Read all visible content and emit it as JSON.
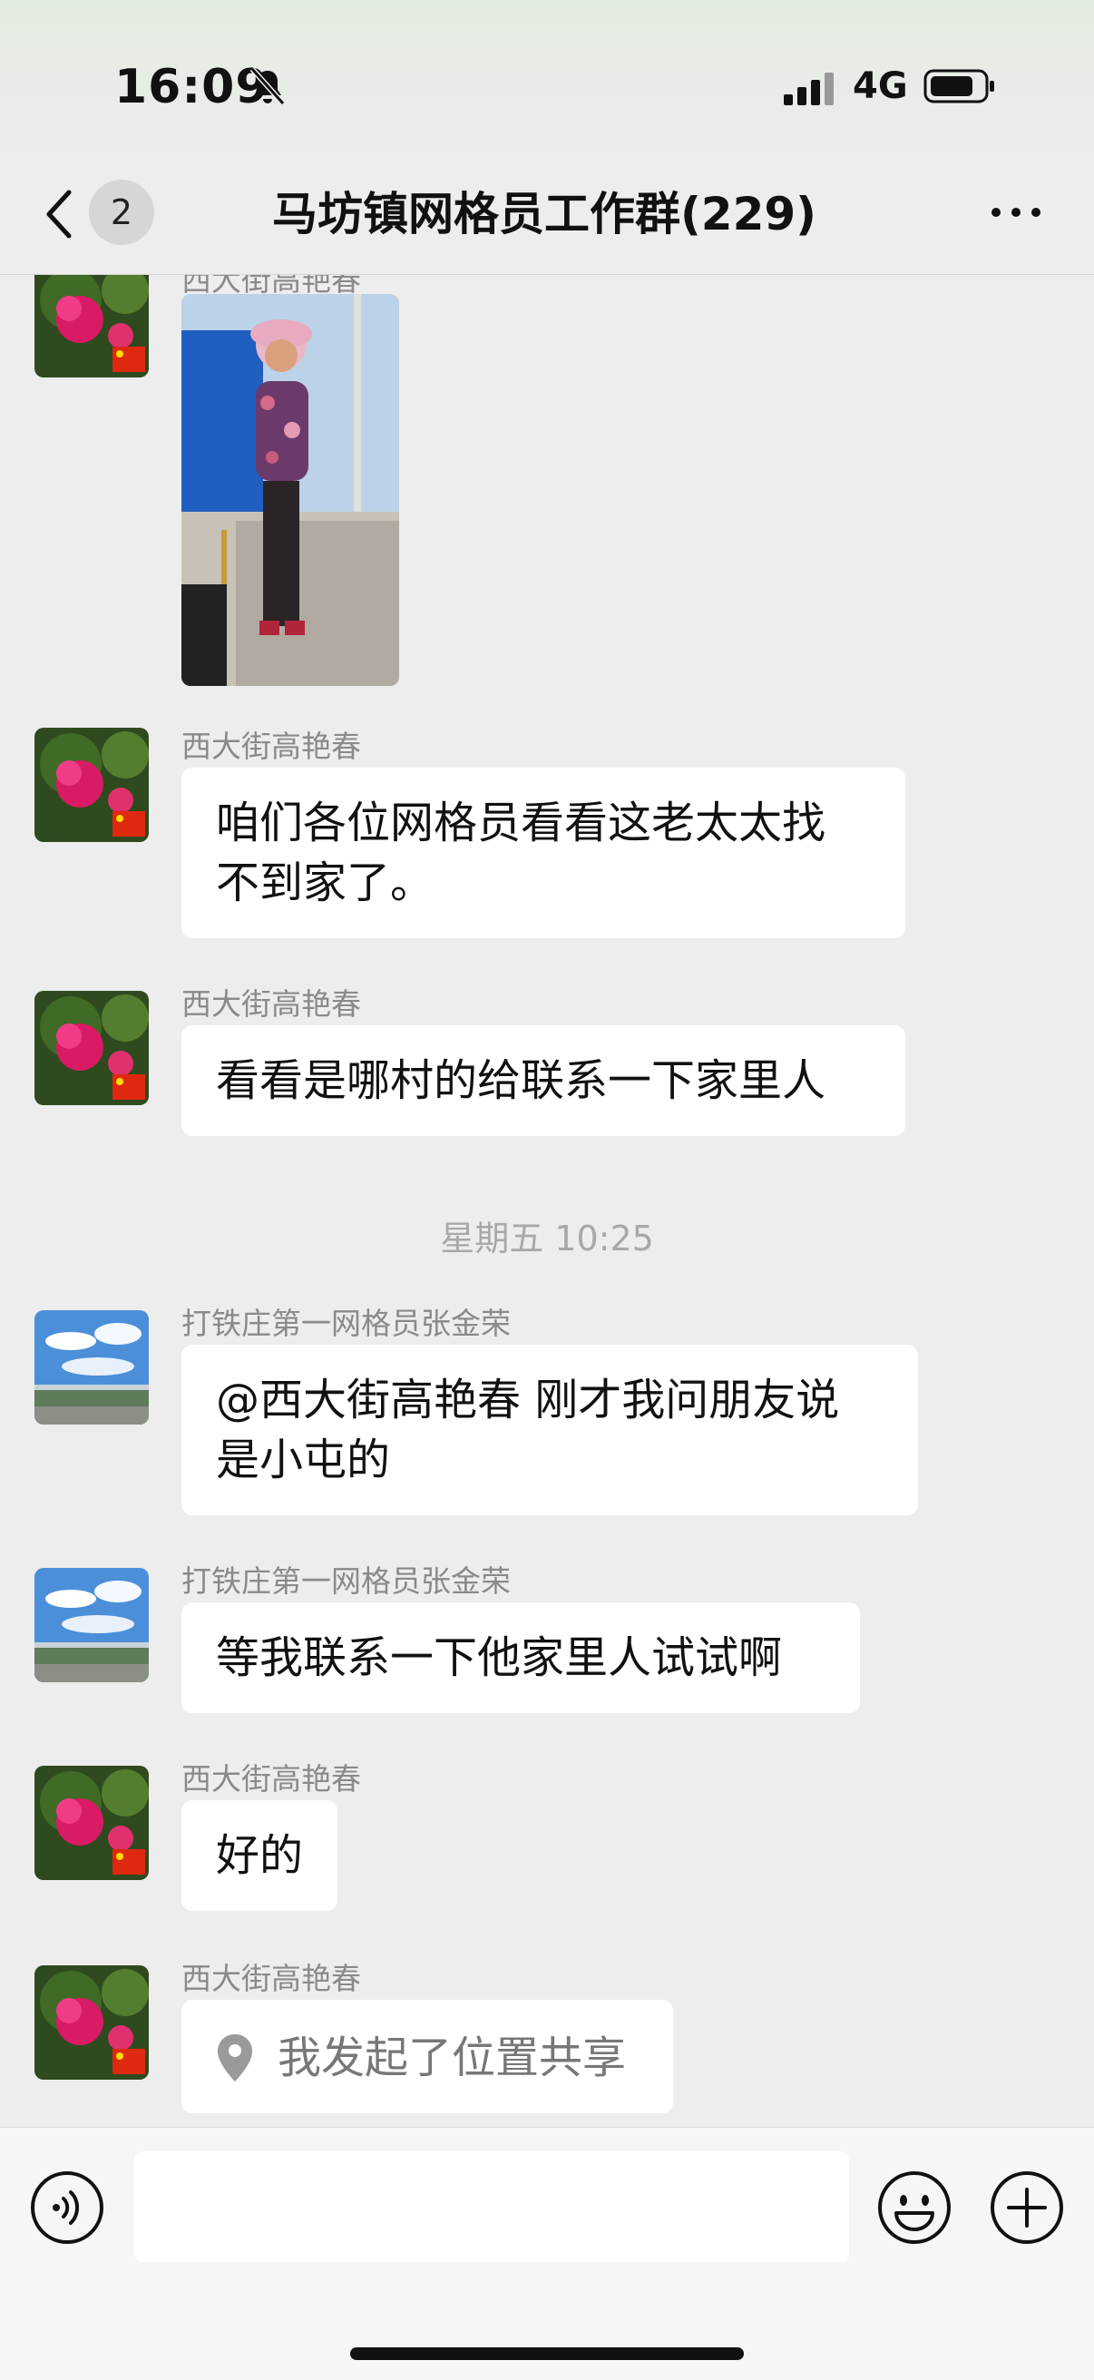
{
  "status_bar": {
    "time": "16:09",
    "network": "4G"
  },
  "nav": {
    "unread_count": "2",
    "title": "马坊镇网格员工作群(229)"
  },
  "messages": [
    {
      "sender": "西大街高艳春",
      "type": "image"
    },
    {
      "sender": "西大街高艳春",
      "line1": "咱们各位网格员看看这老太太找",
      "line2": "不到家了。"
    },
    {
      "sender": "西大街高艳春",
      "text": "看看是哪村的给联系一下家里人"
    },
    {
      "timestamp": "星期五 10:25"
    },
    {
      "sender": "打铁庄第一网格员张金荣",
      "line1": "@西大街高艳春 刚才我问朋友说",
      "line2": "是小屯的"
    },
    {
      "sender": "打铁庄第一网格员张金荣",
      "text": "等我联系一下他家里人试试啊"
    },
    {
      "sender": "西大街高艳春",
      "text": "好的"
    },
    {
      "sender": "西大街高艳春",
      "type": "location",
      "text": "我发起了位置共享"
    }
  ],
  "icons": {
    "back": "chevron-left-icon",
    "more": "more-dots-icon",
    "voice": "voice-icon",
    "emoji": "emoji-icon",
    "plus": "plus-icon",
    "location": "location-pin-icon",
    "silent": "bell-slash-icon"
  },
  "colors": {
    "background": "#ededed",
    "bubble": "#ffffff",
    "sender_text": "#8a8a8a"
  }
}
